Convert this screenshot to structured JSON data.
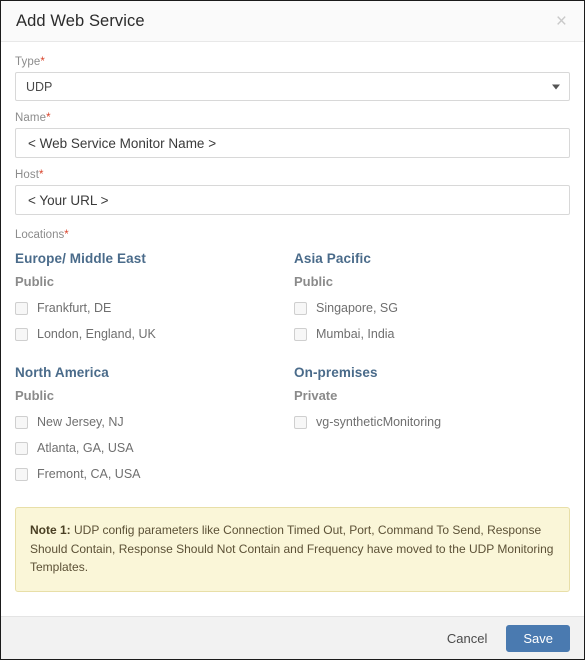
{
  "dialog": {
    "title": "Add Web Service",
    "close_icon": "close-icon",
    "close_glyph": "×"
  },
  "form": {
    "type": {
      "label": "Type",
      "required_marker": "*",
      "selected": "UDP",
      "options": [
        "UDP"
      ]
    },
    "name": {
      "label": "Name",
      "required_marker": "*",
      "value": "",
      "placeholder": "< Web Service Monitor Name >"
    },
    "host": {
      "label": "Host",
      "required_marker": "*",
      "value": "",
      "placeholder": "< Your URL >"
    }
  },
  "locations": {
    "label": "Locations",
    "required_marker": "*",
    "groups": [
      {
        "region": "Europe/ Middle East",
        "visibility": "Public",
        "items": [
          {
            "label": "Frankfurt, DE",
            "checked": false
          },
          {
            "label": "London, England, UK",
            "checked": false
          }
        ]
      },
      {
        "region": "Asia Pacific",
        "visibility": "Public",
        "items": [
          {
            "label": "Singapore, SG",
            "checked": false
          },
          {
            "label": "Mumbai, India",
            "checked": false
          }
        ]
      },
      {
        "region": "North America",
        "visibility": "Public",
        "items": [
          {
            "label": "New Jersey, NJ",
            "checked": false
          },
          {
            "label": "Atlanta, GA, USA",
            "checked": false
          },
          {
            "label": "Fremont, CA, USA",
            "checked": false
          }
        ]
      },
      {
        "region": "On-premises",
        "visibility": "Private",
        "items": [
          {
            "label": "vg-syntheticMonitoring",
            "checked": false
          }
        ]
      }
    ]
  },
  "note": {
    "prefix": "Note 1:",
    "body": " UDP config parameters like Connection Timed Out, Port, Command To Send, Response Should Contain, Response Should Not Contain and Frequency have moved to the UDP Monitoring Templates."
  },
  "footer": {
    "cancel_label": "Cancel",
    "save_label": "Save"
  },
  "colors": {
    "accent": "#4a7ab0",
    "required": "#d9442c",
    "region_heading": "#4a6b8a",
    "note_bg": "#faf6d8",
    "note_border": "#e8dfa8",
    "footer_bg": "#f2f2f2"
  }
}
